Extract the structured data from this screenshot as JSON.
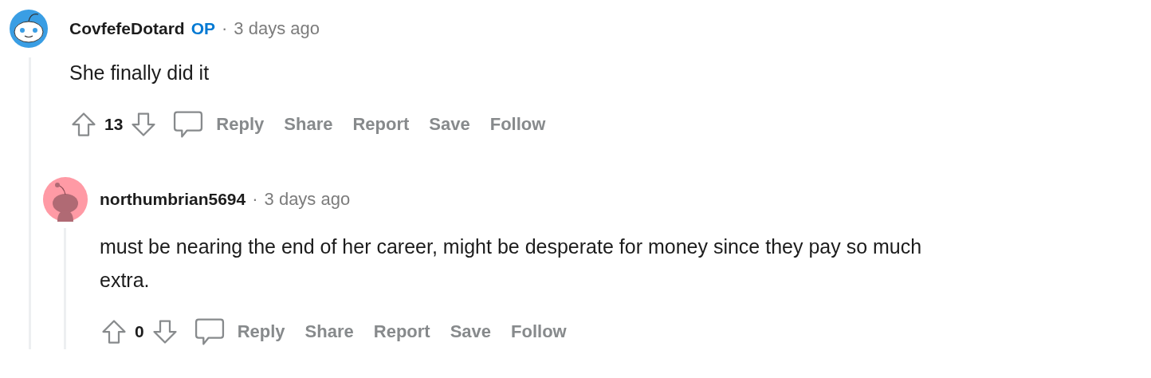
{
  "comments": [
    {
      "author": "CovfefeDotard",
      "badge": "OP",
      "separator": "·",
      "time": "3 days ago",
      "color": "#3a9ee4",
      "body": "She finally did it",
      "score": "13",
      "actions": [
        "Reply",
        "Share",
        "Report",
        "Save",
        "Follow"
      ],
      "replies": [
        {
          "author": "northumbrian5694",
          "separator": "·",
          "time": "3 days ago",
          "color": "#ff9aa5",
          "body": "must be nearing the end of her career, might be desperate for money since they pay so much extra.",
          "score": "0",
          "actions": [
            "Reply",
            "Share",
            "Report",
            "Save",
            "Follow"
          ]
        }
      ]
    }
  ]
}
